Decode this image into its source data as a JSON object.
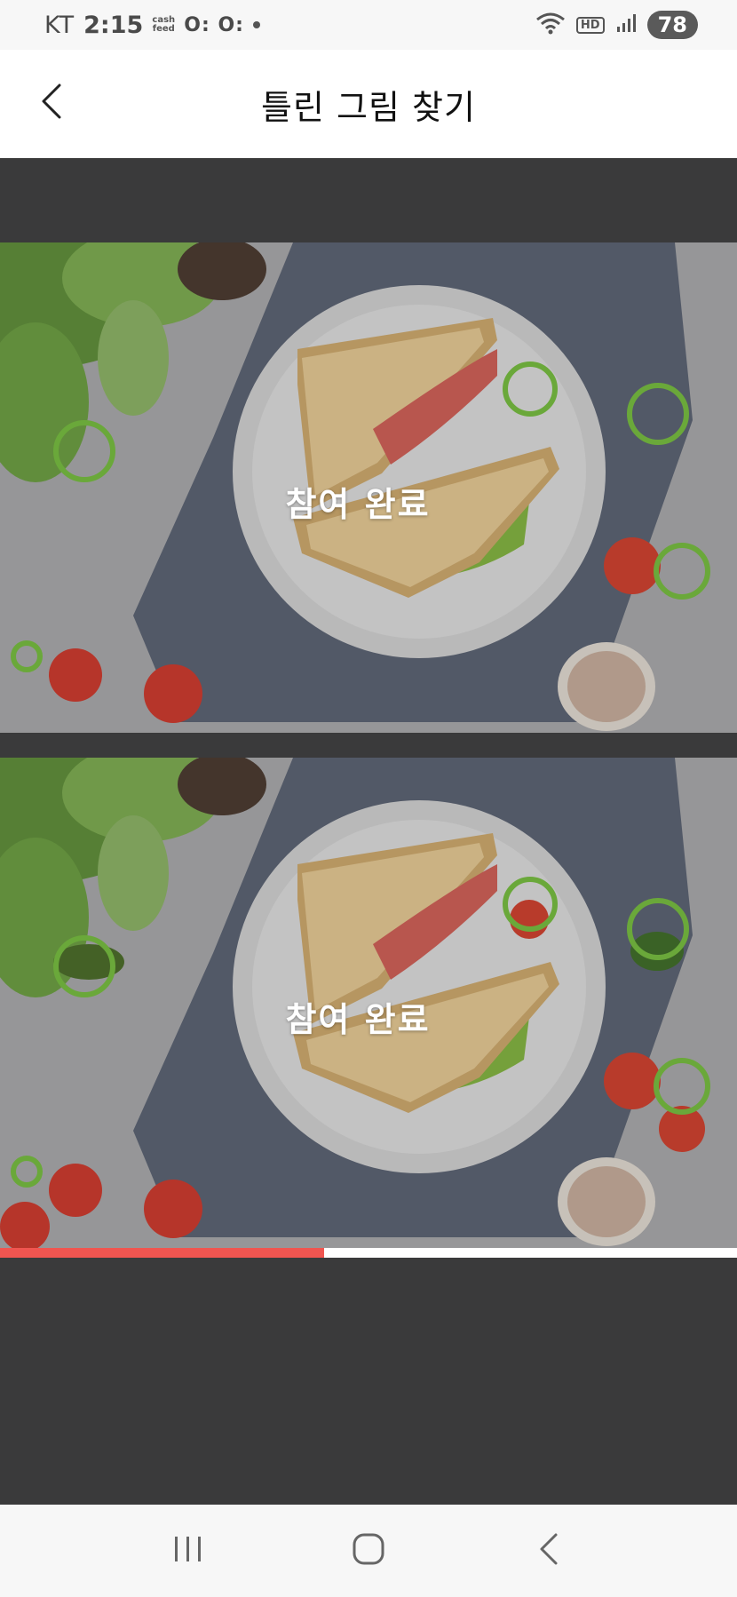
{
  "status_bar": {
    "carrier": "KT",
    "time": "2:15",
    "app_badge": "cash feed",
    "indicators": "O: O:",
    "hd_label": "HD",
    "battery": "78"
  },
  "header": {
    "title": "틀린 그림 찾기",
    "back_icon": "chevron-left-icon"
  },
  "game": {
    "top_image_label": "참여 완료",
    "bottom_image_label": "참여 완료",
    "marker_color": "#6aa83a",
    "progress_percent": 44,
    "progress_color": "#f05550"
  },
  "nav_bar": {
    "recents_icon": "recent-apps-icon",
    "home_icon": "home-icon",
    "back_icon": "back-icon"
  }
}
